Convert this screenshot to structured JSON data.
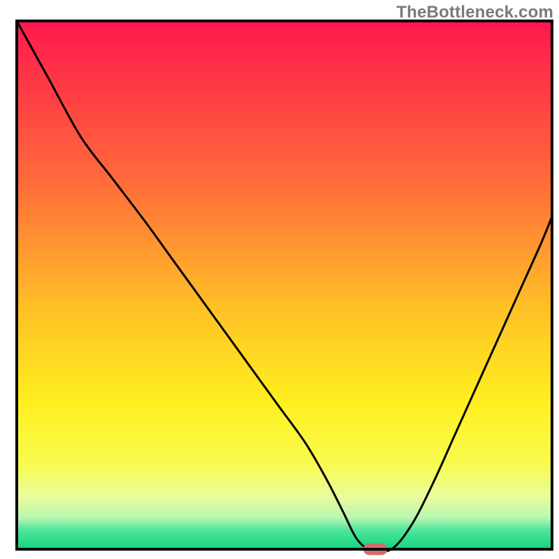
{
  "watermark": "TheBottleneck.com",
  "chart_data": {
    "type": "line",
    "title": "",
    "xlabel": "",
    "ylabel": "",
    "xlim": [
      0,
      100
    ],
    "ylim": [
      0,
      100
    ],
    "grid": false,
    "background_gradient": {
      "stops": [
        {
          "offset": 0.0,
          "color": "#ff184f"
        },
        {
          "offset": 0.3,
          "color": "#ff6a3a"
        },
        {
          "offset": 0.55,
          "color": "#ffc226"
        },
        {
          "offset": 0.72,
          "color": "#ffef1f"
        },
        {
          "offset": 0.84,
          "color": "#f8fb50"
        },
        {
          "offset": 0.9,
          "color": "#eafc9c"
        },
        {
          "offset": 0.94,
          "color": "#b8f7b0"
        },
        {
          "offset": 0.965,
          "color": "#4de39a"
        },
        {
          "offset": 1.0,
          "color": "#12d57e"
        }
      ]
    },
    "series": [
      {
        "name": "bottleneck-curve",
        "color": "#000000",
        "x": [
          0,
          6,
          12,
          18,
          24,
          29,
          34,
          39,
          44,
          49,
          54,
          58,
          61,
          63.5,
          66,
          70,
          74,
          78,
          82,
          86,
          90,
          94,
          98,
          100
        ],
        "y": [
          100,
          89,
          78,
          70,
          62,
          55,
          48,
          41,
          34,
          27,
          20,
          13,
          7,
          2,
          0,
          0,
          5,
          13,
          22,
          31,
          40,
          49,
          58,
          63
        ]
      }
    ],
    "marker": {
      "name": "optimal-point",
      "shape": "rounded-rect",
      "color": "#cf6d6d",
      "x": 67,
      "y": 0,
      "width": 4.5,
      "height": 2.2
    },
    "frame": {
      "stroke": "#000000",
      "stroke_width": 4
    }
  }
}
